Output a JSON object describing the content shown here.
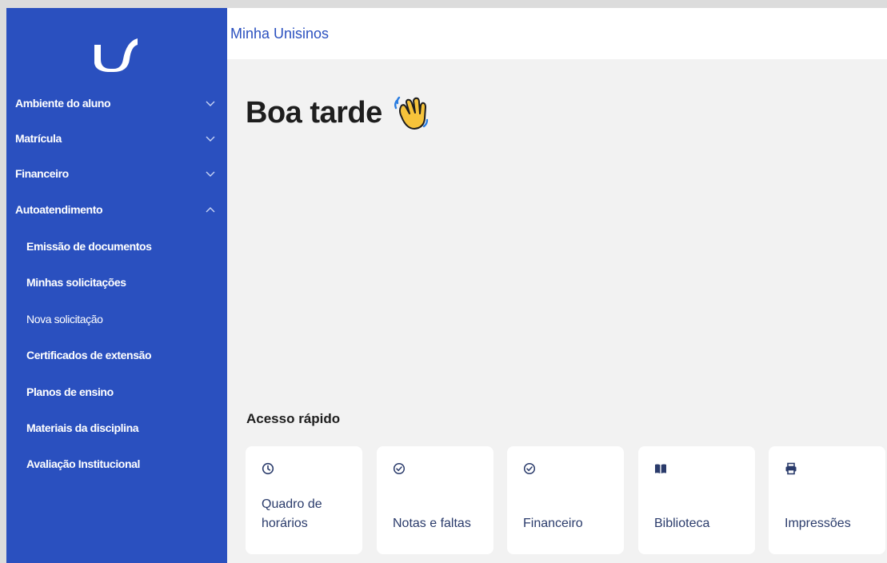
{
  "header": {
    "brand": "Minha Unisinos"
  },
  "greeting": {
    "text": "Boa tarde",
    "emoji_icon": "waving-hand-icon"
  },
  "sidebar": {
    "logo_icon": "unisinos-logo-icon",
    "items": [
      {
        "label": "Ambiente do aluno",
        "expanded": false
      },
      {
        "label": "Matrícula",
        "expanded": false
      },
      {
        "label": "Financeiro",
        "expanded": false
      },
      {
        "label": "Autoatendimento",
        "expanded": true
      }
    ],
    "subitems": [
      {
        "label": "Emissão de documentos"
      },
      {
        "label": "Minhas solicitações"
      },
      {
        "label": "Nova solicitação"
      },
      {
        "label": "Certificados de extensão"
      },
      {
        "label": "Planos de ensino"
      },
      {
        "label": "Materiais da disciplina"
      },
      {
        "label": "Avaliação Institucional"
      }
    ]
  },
  "quick_access": {
    "title": "Acesso rápido",
    "cards": [
      {
        "label": "Quadro de horários",
        "icon": "clock-icon"
      },
      {
        "label": "Notas e faltas",
        "icon": "check-circle-icon"
      },
      {
        "label": "Financeiro",
        "icon": "check-circle-icon"
      },
      {
        "label": "Biblioteca",
        "icon": "book-icon"
      },
      {
        "label": "Impressões",
        "icon": "printer-icon"
      }
    ]
  },
  "colors": {
    "primary": "#2a50bf",
    "card_text": "#2a3b6b",
    "background": "#f2f2f2"
  }
}
